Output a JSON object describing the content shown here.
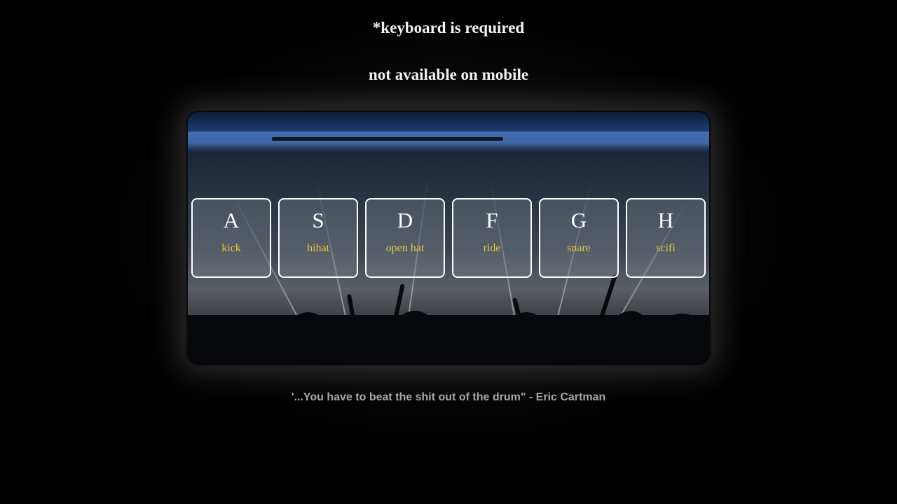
{
  "notices": {
    "keyboard": "*keyboard is required",
    "mobile": "not available on mobile"
  },
  "drum_pad": {
    "keys": [
      {
        "letter": "A",
        "sound": "kick"
      },
      {
        "letter": "S",
        "sound": "hihat"
      },
      {
        "letter": "D",
        "sound": "open hat"
      },
      {
        "letter": "F",
        "sound": "ride"
      },
      {
        "letter": "G",
        "sound": "snare"
      },
      {
        "letter": "H",
        "sound": "scifi"
      }
    ]
  },
  "footer": {
    "quote": "'...You have to beat the shit out of the drum\" - Eric Cartman"
  },
  "colors": {
    "background": "#000000",
    "key_border": "#ffffff",
    "sound_label": "#e8c43a",
    "quote_text": "#a6a6a6"
  }
}
